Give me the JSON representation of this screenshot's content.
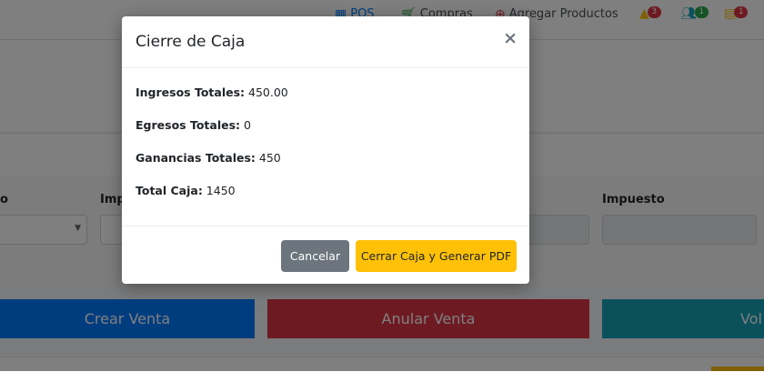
{
  "topbar": {
    "links": [
      {
        "label": "POS",
        "icon": "cash-register-icon"
      },
      {
        "label": "Compras",
        "icon": "cart-icon"
      },
      {
        "label": "Agregar Productos",
        "icon": "plus-circle-icon"
      }
    ],
    "notifications": [
      {
        "icon": "warning-icon",
        "count": "3",
        "color": "#dc3545"
      },
      {
        "icon": "users-icon",
        "count": "1",
        "color": "#28a745"
      },
      {
        "icon": "list-icon",
        "count": "1",
        "color": "#dc3545"
      }
    ]
  },
  "form": {
    "label_left": "o",
    "label_mid": "Imp",
    "label_right": "Impuesto"
  },
  "actions": {
    "crear": "Crear Venta",
    "anular": "Anular Venta",
    "volver": "Vol"
  },
  "modal": {
    "title": "Cierre de Caja",
    "close_symbol": "×",
    "rows": [
      {
        "label": "Ingresos Totales:",
        "value": " 450.00"
      },
      {
        "label": "Egresos Totales:",
        "value": " 0"
      },
      {
        "label": "Ganancias Totales:",
        "value": " 450"
      },
      {
        "label": "Total Caja:",
        "value": " 1450"
      }
    ],
    "cancel_label": "Cancelar",
    "confirm_label": "Cerrar Caja y Generar PDF"
  },
  "colors": {
    "primary": "#007bff",
    "danger": "#dc3545",
    "teal": "#17a2b8",
    "warning": "#ffc107",
    "secondary": "#6c757d"
  }
}
